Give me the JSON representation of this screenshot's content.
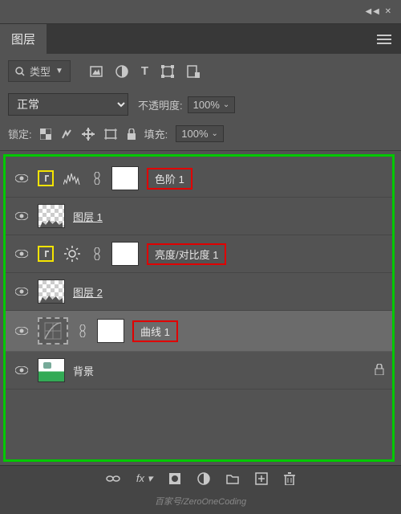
{
  "panel": {
    "title": "图层"
  },
  "filter": {
    "label": "类型"
  },
  "blend": {
    "mode": "正常",
    "opacity_label": "不透明度:",
    "opacity_value": "100%"
  },
  "lock": {
    "label": "锁定:",
    "fill_label": "填充:",
    "fill_value": "100%"
  },
  "layers": [
    {
      "name": "色阶 1"
    },
    {
      "name": "图层 1"
    },
    {
      "name": "亮度/对比度 1"
    },
    {
      "name": "图层 2"
    },
    {
      "name": "曲线 1"
    },
    {
      "name": "背景"
    }
  ],
  "credit": "百家号/ZeroOneCoding"
}
